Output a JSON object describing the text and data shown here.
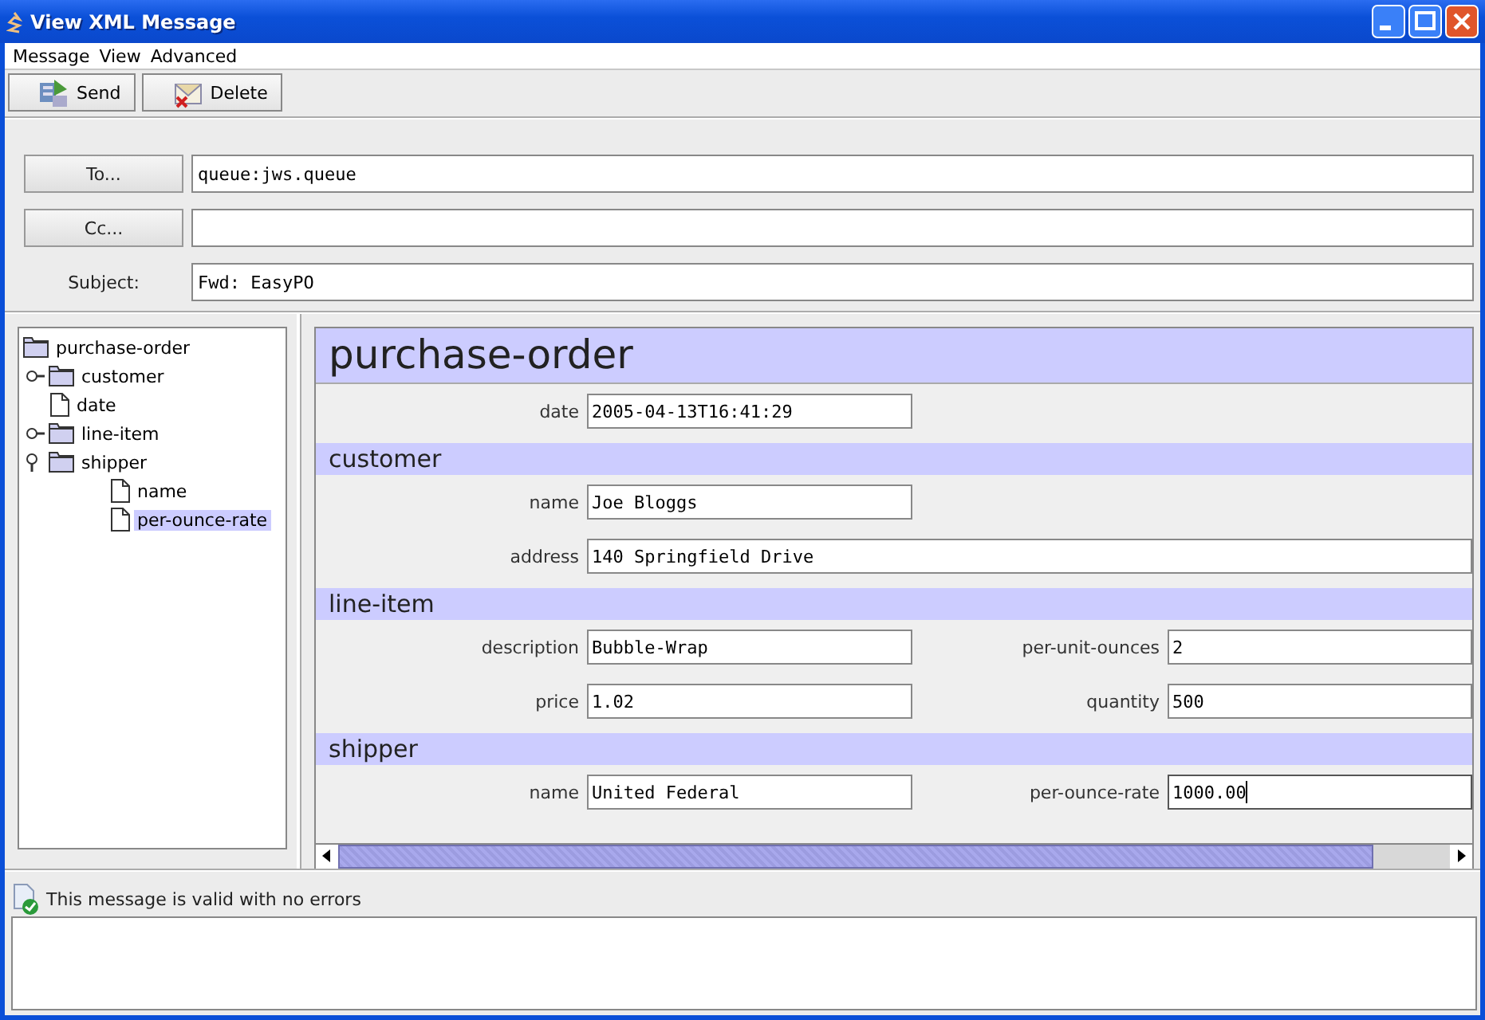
{
  "window": {
    "title": "View XML Message"
  },
  "menu": [
    "Message",
    "View",
    "Advanced"
  ],
  "toolbar": [
    {
      "label": "Send",
      "kind": "send"
    },
    {
      "label": "Delete",
      "kind": "delete"
    }
  ],
  "addressing": [
    {
      "label": "To...",
      "kind": "button",
      "value": "queue:jws.queue"
    },
    {
      "label": "Cc...",
      "kind": "button"
    },
    {
      "label": "Subject:",
      "kind": "label",
      "value": "Fwd: EasyPO"
    }
  ],
  "tree": [
    {
      "label": "purchase-order",
      "kind": "folder",
      "selected": false,
      "children": [
        {
          "label": "customer",
          "kind": "folder",
          "expanded": false,
          "selected": false
        },
        {
          "label": "date",
          "kind": "file",
          "selected": false
        },
        {
          "label": "line-item",
          "kind": "folder",
          "expanded": false,
          "selected": false
        },
        {
          "label": "shipper",
          "kind": "folder",
          "expanded": true,
          "selected": false,
          "children": [
            {
              "label": "name",
              "kind": "file",
              "selected": false
            },
            {
              "label": "per-ounce-rate",
              "kind": "file",
              "selected": true
            }
          ]
        }
      ]
    }
  ],
  "form": [
    {
      "title": "purchase-order",
      "kind": "root",
      "rows": [
        [
          {
            "label": "date",
            "value": "2005-04-13T16:41:29",
            "wide": false,
            "focused": false
          }
        ]
      ]
    },
    {
      "title": "customer",
      "kind": "group",
      "rows": [
        [
          {
            "label": "name",
            "value": "Joe Bloggs",
            "wide": false,
            "focused": false
          }
        ],
        [
          {
            "label": "address",
            "value": "140 Springfield Drive",
            "wide": true,
            "focused": false
          }
        ]
      ]
    },
    {
      "title": "line-item",
      "kind": "group",
      "rows": [
        [
          {
            "label": "description",
            "value": "Bubble-Wrap",
            "wide": false,
            "focused": false
          },
          {
            "label": "per-unit-ounces",
            "value": "2",
            "wide": false,
            "focused": false
          }
        ],
        [
          {
            "label": "price",
            "value": "1.02",
            "wide": false,
            "focused": false
          },
          {
            "label": "quantity",
            "value": "500",
            "wide": false,
            "focused": false
          }
        ]
      ]
    },
    {
      "title": "shipper",
      "kind": "group",
      "rows": [
        [
          {
            "label": "name",
            "value": "United Federal",
            "wide": false,
            "focused": false
          },
          {
            "label": "per-ounce-rate",
            "value": "1000.00",
            "wide": false,
            "focused": true
          }
        ]
      ]
    }
  ],
  "status": {
    "message": "This message is valid with no errors",
    "valid": true
  }
}
